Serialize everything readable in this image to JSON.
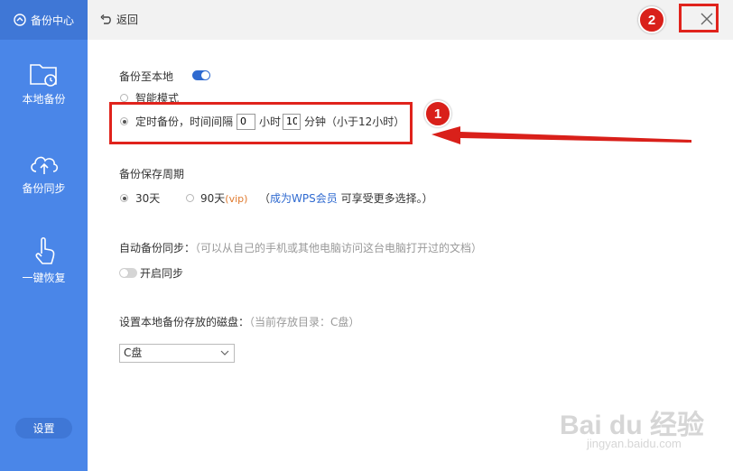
{
  "sidebar": {
    "brand": "备份中心",
    "items": [
      {
        "label": "本地备份",
        "icon": "folder-clock-icon"
      },
      {
        "label": "备份同步",
        "icon": "cloud-upload-icon"
      },
      {
        "label": "一键恢复",
        "icon": "hand-pointer-icon"
      }
    ],
    "settings": "设置"
  },
  "topbar": {
    "back": "返回"
  },
  "annotations": {
    "badge1": "1",
    "badge2": "2"
  },
  "local_backup": {
    "title": "备份至本地",
    "enabled": true,
    "smart_mode": "智能模式",
    "timed_prefix": "定时备份，时间间隔",
    "hours_value": "0",
    "hours_unit": "小时",
    "minutes_value": "10",
    "minutes_unit": "分钟（小于12小时）"
  },
  "retention": {
    "title": "备份保存周期",
    "opt30": "30天",
    "opt90": "90天",
    "vip": "(vip)",
    "note_open": "（",
    "note_link": "成为WPS会员",
    "note_rest": " 可享受更多选择。）"
  },
  "auto_sync": {
    "title": "自动备份同步：",
    "desc": "（可以从自己的手机或其他电脑访问这台电脑打开过的文档）",
    "toggle_label": "开启同步",
    "enabled": false
  },
  "disk": {
    "title": "设置本地备份存放的磁盘：",
    "current": "（当前存放目录：C盘）",
    "selected": "C盘"
  },
  "watermark": {
    "logo": "Bai du 经验",
    "url": "jingyan.baidu.com"
  },
  "colors": {
    "sidebar": "#4a86e8",
    "accent": "#2f6ad0",
    "annotation": "#e0231c"
  }
}
